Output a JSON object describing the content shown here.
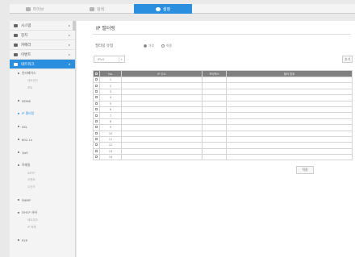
{
  "tabs": [
    {
      "label": "라이브"
    },
    {
      "label": "검색"
    },
    {
      "label": "설정"
    }
  ],
  "sidebar": {
    "items": [
      {
        "label": "시스템"
      },
      {
        "label": "장치"
      },
      {
        "label": "카메라"
      },
      {
        "label": "이벤트"
      },
      {
        "label": "네트워크"
      }
    ],
    "sub_items": [
      {
        "label": "인터페이스"
      },
      {
        "label": "DDNS"
      },
      {
        "label": "IP 필터링"
      },
      {
        "label": "SSL"
      },
      {
        "label": "802.1x"
      },
      {
        "label": "QoS"
      },
      {
        "label": "이메일"
      },
      {
        "label": "SNMP"
      },
      {
        "label": "DHCP 서버"
      },
      {
        "label": "P2P"
      }
    ],
    "leaves_interface": [
      "네트워크",
      "포트"
    ],
    "leaves_email": [
      "SMTP",
      "이벤트",
      "수신자"
    ],
    "leaves_dhcp": [
      "네트워크",
      "IP 목록"
    ]
  },
  "page": {
    "title": "IP 필터링",
    "filter_label": "필터링 유형",
    "radio_allow": "거부",
    "radio_deny": "허용",
    "ip_type_value": "IPv4",
    "add_button": "추가",
    "apply_button": "적용"
  },
  "table": {
    "headers": [
      "No.",
      "IP 주소",
      "프리픽스",
      "필터 범위"
    ],
    "rows": [
      "1",
      "2",
      "3",
      "4",
      "5",
      "6",
      "7",
      "8",
      "9",
      "10",
      "11",
      "12",
      "13",
      "14"
    ]
  }
}
